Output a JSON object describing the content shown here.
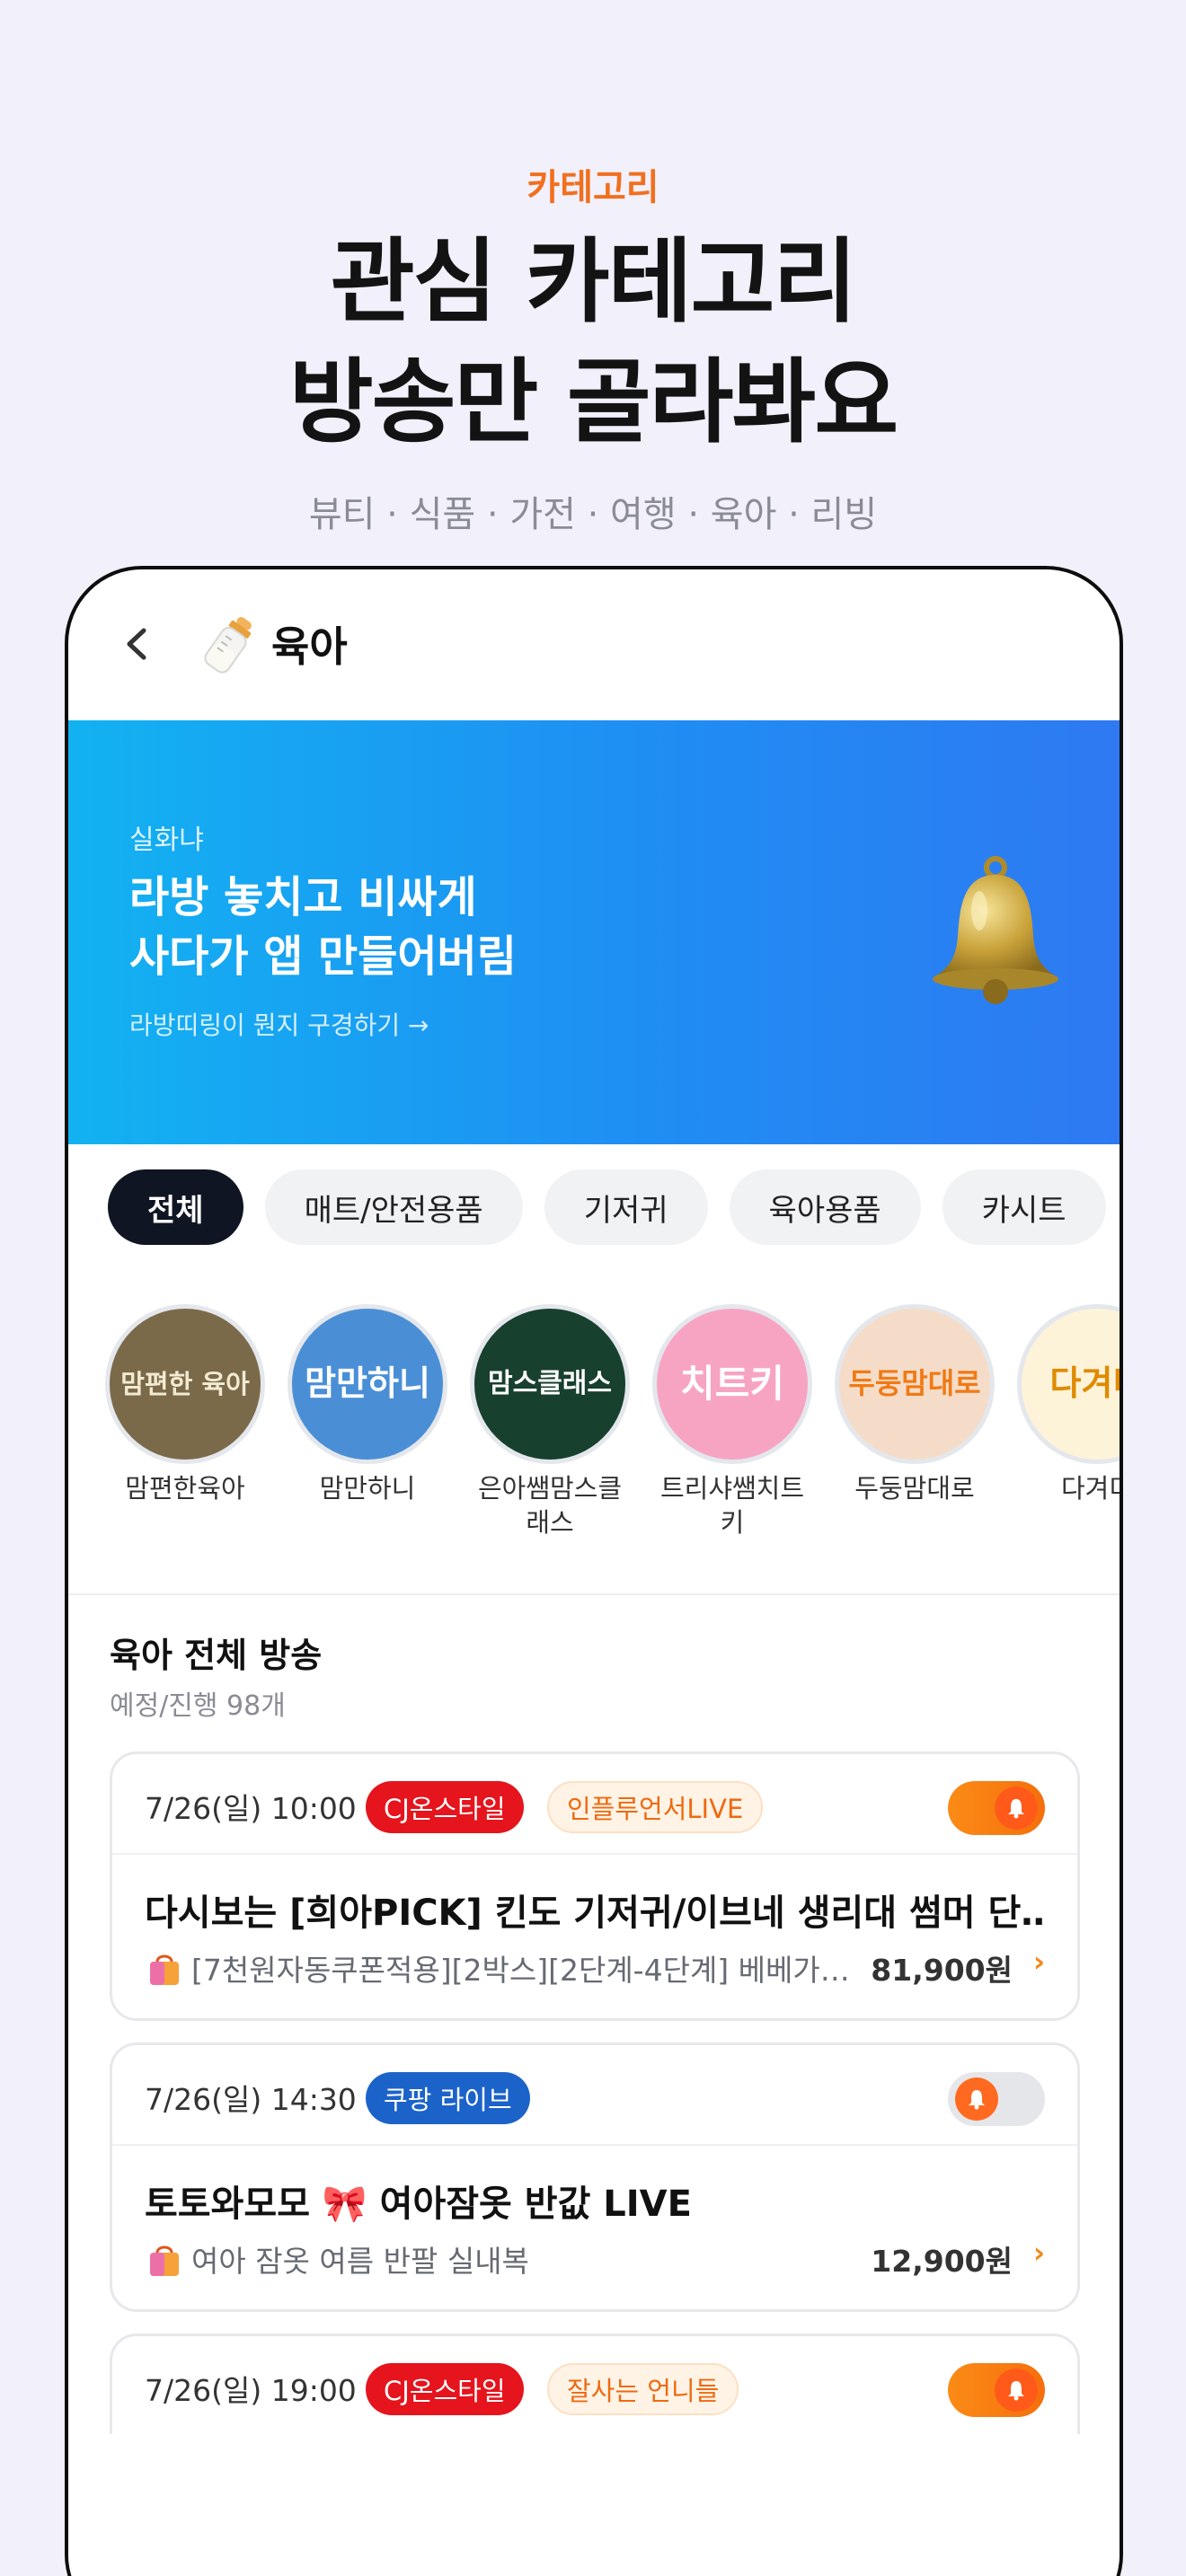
{
  "hero": {
    "kicker": "카테고리",
    "title_line1": "관심 카테고리",
    "title_line2": "방송만 골라봐요",
    "subtitle": "뷰티 · 식품 · 가전 · 여행 · 육아 · 리빙"
  },
  "topbar": {
    "title": "육아",
    "back_icon": "chevron-left-icon",
    "category_icon": "baby-bottle-icon"
  },
  "banner": {
    "kicker": "실화냐",
    "title_line1": "라방 놓치고 비싸게",
    "title_line2": "사다가 앱 만들어버림",
    "link": "라방띠링이 뭔지 구경하기 →",
    "icon": "bell-icon",
    "gradient": [
      "#12b2f1",
      "#2e79f2"
    ]
  },
  "chips": [
    {
      "label": "전체",
      "active": true
    },
    {
      "label": "매트/안전용품",
      "active": false
    },
    {
      "label": "기저귀",
      "active": false
    },
    {
      "label": "육아용품",
      "active": false
    },
    {
      "label": "카시트",
      "active": false
    }
  ],
  "channels": [
    {
      "name": "맘편한육아",
      "logo": "맘편한 육아",
      "bg": "#7a6a4a",
      "fg": "#f3ead2"
    },
    {
      "name": "맘만하니",
      "logo": "맘만하니",
      "bg": "#4a8fd6",
      "fg": "#ffffff"
    },
    {
      "name": "은아쌤맘스클래스",
      "logo": "맘스클래스",
      "bg": "#17402e",
      "fg": "#ffffff"
    },
    {
      "name": "트리샤쌤치트키",
      "logo": "치트키",
      "bg": "#f7a4c3",
      "fg": "#ffffff"
    },
    {
      "name": "두둥맘대로",
      "logo": "두둥맘대로",
      "bg": "#f5dcc8",
      "fg": "#f07a14"
    },
    {
      "name": "다겨미",
      "logo": "다겨미",
      "bg": "#fdf3d8",
      "fg": "#e08a00"
    }
  ],
  "section": {
    "title": "육아 전체 방송",
    "subtitle": "예정/진행 98개"
  },
  "broadcasts": [
    {
      "time": "7/26(일) 10:00",
      "tags": [
        {
          "label": "CJ온스타일",
          "style": "red"
        },
        {
          "label": "인플루언서LIVE",
          "style": "orange"
        }
      ],
      "alarm_on": true,
      "title": "다시보는 [희아PICK] 킨도 기저귀/이브네 생리대 썸머 단…",
      "product": "[7천원자동쿠폰적용][2박스][2단계-4단계] 베베가…",
      "price": "81,900원"
    },
    {
      "time": "7/26(일) 14:30",
      "tags": [
        {
          "label": "쿠팡 라이브",
          "style": "blue"
        }
      ],
      "alarm_on": false,
      "title": "토토와모모 🎀 여아잠옷 반값 LIVE",
      "product": "여아 잠옷 여름 반팔 실내복",
      "price": "12,900원"
    },
    {
      "time": "7/26(일) 19:00",
      "tags": [
        {
          "label": "CJ온스타일",
          "style": "red"
        },
        {
          "label": "잘사는 언니들",
          "style": "orange"
        }
      ],
      "alarm_on": true
    }
  ],
  "colors": {
    "accent": "#f26f1d",
    "background": "#f1f0fb",
    "chip_active": "#0f1522"
  }
}
